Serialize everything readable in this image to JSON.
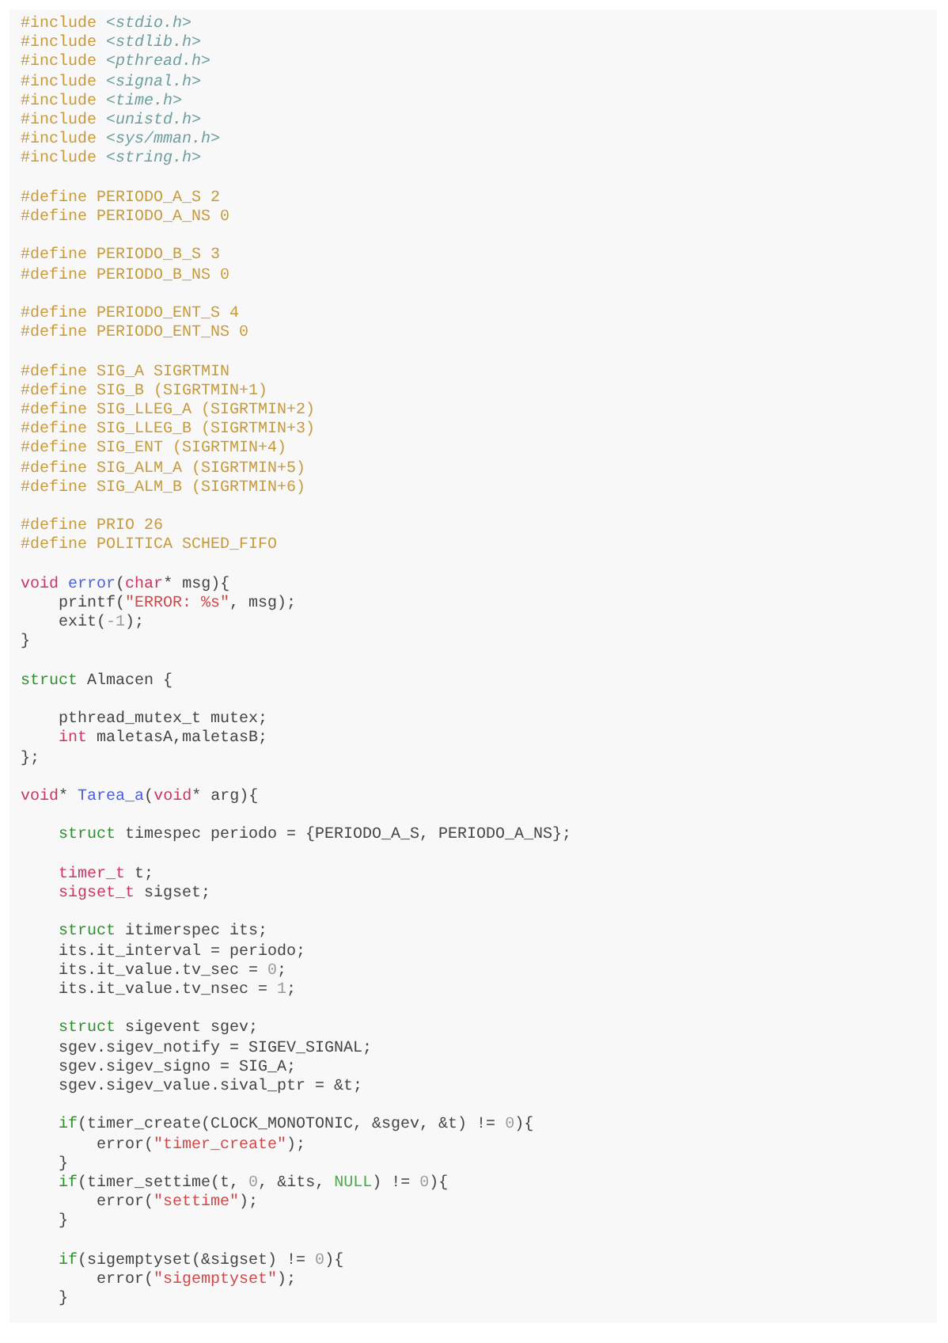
{
  "code_blocks": [
    {
      "lines": [
        {
          "tokens": [
            {
              "kind": "pp",
              "text": "#include "
            },
            {
              "kind": "hdr",
              "text": "<stdio.h>"
            }
          ]
        },
        {
          "tokens": [
            {
              "kind": "pp",
              "text": "#include "
            },
            {
              "kind": "hdr",
              "text": "<stdlib.h>"
            }
          ]
        },
        {
          "tokens": [
            {
              "kind": "pp",
              "text": "#include "
            },
            {
              "kind": "hdr",
              "text": "<pthread.h>"
            }
          ]
        },
        {
          "tokens": [
            {
              "kind": "pp",
              "text": "#include "
            },
            {
              "kind": "hdr",
              "text": "<signal.h>"
            }
          ]
        },
        {
          "tokens": [
            {
              "kind": "pp",
              "text": "#include "
            },
            {
              "kind": "hdr",
              "text": "<time.h>"
            }
          ]
        },
        {
          "tokens": [
            {
              "kind": "pp",
              "text": "#include "
            },
            {
              "kind": "hdr",
              "text": "<unistd.h>"
            }
          ]
        },
        {
          "tokens": [
            {
              "kind": "pp",
              "text": "#include "
            },
            {
              "kind": "hdr",
              "text": "<sys/mman.h>"
            }
          ]
        },
        {
          "tokens": [
            {
              "kind": "pp",
              "text": "#include "
            },
            {
              "kind": "hdr",
              "text": "<string.h>"
            }
          ]
        }
      ]
    },
    {
      "lines": [
        {
          "tokens": [
            {
              "kind": "pp",
              "text": "#define PERIODO_A_S 2"
            }
          ]
        },
        {
          "tokens": [
            {
              "kind": "pp",
              "text": "#define PERIODO_A_NS 0"
            }
          ]
        }
      ]
    },
    {
      "lines": [
        {
          "tokens": [
            {
              "kind": "pp",
              "text": "#define PERIODO_B_S 3"
            }
          ]
        },
        {
          "tokens": [
            {
              "kind": "pp",
              "text": "#define PERIODO_B_NS 0"
            }
          ]
        }
      ]
    },
    {
      "lines": [
        {
          "tokens": [
            {
              "kind": "pp",
              "text": "#define PERIODO_ENT_S 4"
            }
          ]
        },
        {
          "tokens": [
            {
              "kind": "pp",
              "text": "#define PERIODO_ENT_NS 0"
            }
          ]
        }
      ]
    },
    {
      "lines": [
        {
          "tokens": [
            {
              "kind": "pp",
              "text": "#define SIG_A SIGRTMIN"
            }
          ]
        },
        {
          "tokens": [
            {
              "kind": "pp",
              "text": "#define SIG_B (SIGRTMIN+1)"
            }
          ]
        },
        {
          "tokens": [
            {
              "kind": "pp",
              "text": "#define SIG_LLEG_A (SIGRTMIN+2)"
            }
          ]
        },
        {
          "tokens": [
            {
              "kind": "pp",
              "text": "#define SIG_LLEG_B (SIGRTMIN+3)"
            }
          ]
        },
        {
          "tokens": [
            {
              "kind": "pp",
              "text": "#define SIG_ENT (SIGRTMIN+4)"
            }
          ]
        },
        {
          "tokens": [
            {
              "kind": "pp",
              "text": "#define SIG_ALM_A (SIGRTMIN+5)"
            }
          ]
        },
        {
          "tokens": [
            {
              "kind": "pp",
              "text": "#define SIG_ALM_B (SIGRTMIN+6)"
            }
          ]
        }
      ]
    },
    {
      "lines": [
        {
          "tokens": [
            {
              "kind": "pp",
              "text": "#define PRIO 26"
            }
          ]
        },
        {
          "tokens": [
            {
              "kind": "pp",
              "text": "#define POLITICA SCHED_FIFO"
            }
          ]
        }
      ]
    },
    {
      "lines": [
        {
          "tokens": [
            {
              "kind": "kw",
              "text": "void"
            },
            {
              "kind": "fn",
              "text": " error"
            },
            {
              "kind": "pl",
              "text": "("
            },
            {
              "kind": "kw",
              "text": "char"
            },
            {
              "kind": "pl",
              "text": "* msg){"
            }
          ]
        },
        {
          "tokens": [
            {
              "kind": "pl",
              "text": "    printf("
            },
            {
              "kind": "str",
              "text": "\"ERROR: %s\""
            },
            {
              "kind": "pl",
              "text": ", msg);"
            }
          ]
        },
        {
          "tokens": [
            {
              "kind": "pl",
              "text": "    exit("
            },
            {
              "kind": "num",
              "text": "-1"
            },
            {
              "kind": "pl",
              "text": ");"
            }
          ]
        },
        {
          "tokens": [
            {
              "kind": "pl",
              "text": "}"
            }
          ]
        }
      ]
    },
    {
      "lines": [
        {
          "tokens": [
            {
              "kind": "st",
              "text": "struct"
            },
            {
              "kind": "pl",
              "text": " Almacen {"
            }
          ]
        }
      ]
    },
    {
      "lines": [
        {
          "tokens": [
            {
              "kind": "pl",
              "text": "    pthread_mutex_t mutex;"
            }
          ]
        },
        {
          "tokens": [
            {
              "kind": "kw",
              "text": "    int"
            },
            {
              "kind": "pl",
              "text": " maletasA,maletasB;"
            }
          ]
        },
        {
          "tokens": [
            {
              "kind": "pl",
              "text": "};"
            }
          ]
        }
      ]
    },
    {
      "lines": [
        {
          "tokens": [
            {
              "kind": "kw",
              "text": "void"
            },
            {
              "kind": "pl",
              "text": "* "
            },
            {
              "kind": "fn",
              "text": "Tarea_a"
            },
            {
              "kind": "pl",
              "text": "("
            },
            {
              "kind": "kw",
              "text": "void"
            },
            {
              "kind": "pl",
              "text": "* arg){"
            }
          ]
        }
      ]
    },
    {
      "lines": [
        {
          "tokens": [
            {
              "kind": "st",
              "text": "    struct"
            },
            {
              "kind": "pl",
              "text": " timespec periodo = {PERIODO_A_S, PERIODO_A_NS};"
            }
          ]
        }
      ]
    },
    {
      "lines": [
        {
          "tokens": [
            {
              "kind": "kw",
              "text": "    timer_t"
            },
            {
              "kind": "pl",
              "text": " t;"
            }
          ]
        },
        {
          "tokens": [
            {
              "kind": "kw",
              "text": "    sigset_t"
            },
            {
              "kind": "pl",
              "text": " sigset;"
            }
          ]
        }
      ]
    },
    {
      "lines": [
        {
          "tokens": [
            {
              "kind": "st",
              "text": "    struct"
            },
            {
              "kind": "pl",
              "text": " itimerspec its;"
            }
          ]
        },
        {
          "tokens": [
            {
              "kind": "pl",
              "text": "    its.it_interval = periodo;"
            }
          ]
        },
        {
          "tokens": [
            {
              "kind": "pl",
              "text": "    its.it_value.tv_sec = "
            },
            {
              "kind": "num",
              "text": "0"
            },
            {
              "kind": "pl",
              "text": ";"
            }
          ]
        },
        {
          "tokens": [
            {
              "kind": "pl",
              "text": "    its.it_value.tv_nsec = "
            },
            {
              "kind": "num",
              "text": "1"
            },
            {
              "kind": "pl",
              "text": ";"
            }
          ]
        }
      ]
    },
    {
      "lines": [
        {
          "tokens": [
            {
              "kind": "st",
              "text": "    struct"
            },
            {
              "kind": "pl",
              "text": " sigevent sgev;"
            }
          ]
        },
        {
          "tokens": [
            {
              "kind": "pl",
              "text": "    sgev.sigev_notify = SIGEV_SIGNAL;"
            }
          ]
        },
        {
          "tokens": [
            {
              "kind": "pl",
              "text": "    sgev.sigev_signo = SIG_A;"
            }
          ]
        },
        {
          "tokens": [
            {
              "kind": "pl",
              "text": "    sgev.sigev_value.sival_ptr = &t;"
            }
          ]
        }
      ]
    },
    {
      "lines": [
        {
          "tokens": [
            {
              "kind": "st",
              "text": "    if"
            },
            {
              "kind": "pl",
              "text": "(timer_create(CLOCK_MONOTONIC, &sgev, &t) != "
            },
            {
              "kind": "num",
              "text": "0"
            },
            {
              "kind": "pl",
              "text": "){"
            }
          ]
        },
        {
          "tokens": [
            {
              "kind": "pl",
              "text": "        error("
            },
            {
              "kind": "str",
              "text": "\"timer_create\""
            },
            {
              "kind": "pl",
              "text": ");"
            }
          ]
        },
        {
          "tokens": [
            {
              "kind": "pl",
              "text": "    }"
            }
          ]
        },
        {
          "tokens": [
            {
              "kind": "st",
              "text": "    if"
            },
            {
              "kind": "pl",
              "text": "(timer_settime(t, "
            },
            {
              "kind": "num",
              "text": "0"
            },
            {
              "kind": "pl",
              "text": ", &its, "
            },
            {
              "kind": "lit",
              "text": "NULL"
            },
            {
              "kind": "pl",
              "text": ") != "
            },
            {
              "kind": "num",
              "text": "0"
            },
            {
              "kind": "pl",
              "text": "){"
            }
          ]
        },
        {
          "tokens": [
            {
              "kind": "pl",
              "text": "        error("
            },
            {
              "kind": "str",
              "text": "\"settime\""
            },
            {
              "kind": "pl",
              "text": ");"
            }
          ]
        },
        {
          "tokens": [
            {
              "kind": "pl",
              "text": "    }"
            }
          ]
        }
      ]
    },
    {
      "lines": [
        {
          "tokens": [
            {
              "kind": "st",
              "text": "    if"
            },
            {
              "kind": "pl",
              "text": "(sigemptyset(&sigset) != "
            },
            {
              "kind": "num",
              "text": "0"
            },
            {
              "kind": "pl",
              "text": "){"
            }
          ]
        },
        {
          "tokens": [
            {
              "kind": "pl",
              "text": "        error("
            },
            {
              "kind": "str",
              "text": "\"sigemptyset\""
            },
            {
              "kind": "pl",
              "text": ");"
            }
          ]
        },
        {
          "tokens": [
            {
              "kind": "pl",
              "text": "    }"
            }
          ]
        }
      ]
    }
  ]
}
